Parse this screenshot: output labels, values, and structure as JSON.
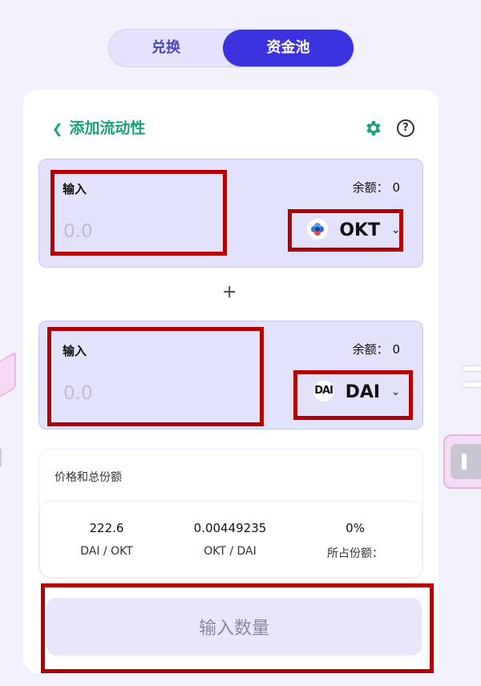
{
  "tabs": {
    "exchange": "兑换",
    "pool": "资金池"
  },
  "header": {
    "back_label": "添加流动性"
  },
  "input_a": {
    "label": "输入",
    "balance_label": "余额：",
    "balance_value": "0",
    "placeholder": "0.0",
    "token": "OKT"
  },
  "plus_sign": "+",
  "input_b": {
    "label": "输入",
    "balance_label": "余额：",
    "balance_value": "0",
    "placeholder": "0.0",
    "token": "DAI",
    "token_logo_text": "DAI"
  },
  "price": {
    "title": "价格和总份额",
    "stats": [
      {
        "value": "222.6",
        "unit": "DAI / OKT"
      },
      {
        "value": "0.00449235",
        "unit": "OKT / DAI"
      },
      {
        "value": "0%",
        "unit": "所占份额："
      }
    ]
  },
  "submit_label": "输入数量",
  "colors": {
    "accent": "#3b33e0",
    "brand_green": "#1aa07a",
    "annotation": "#b30000"
  },
  "icons": [
    "chevron-left-icon",
    "gear-icon",
    "help-icon",
    "okt-token-icon",
    "dai-token-icon",
    "chevron-down-icon"
  ]
}
